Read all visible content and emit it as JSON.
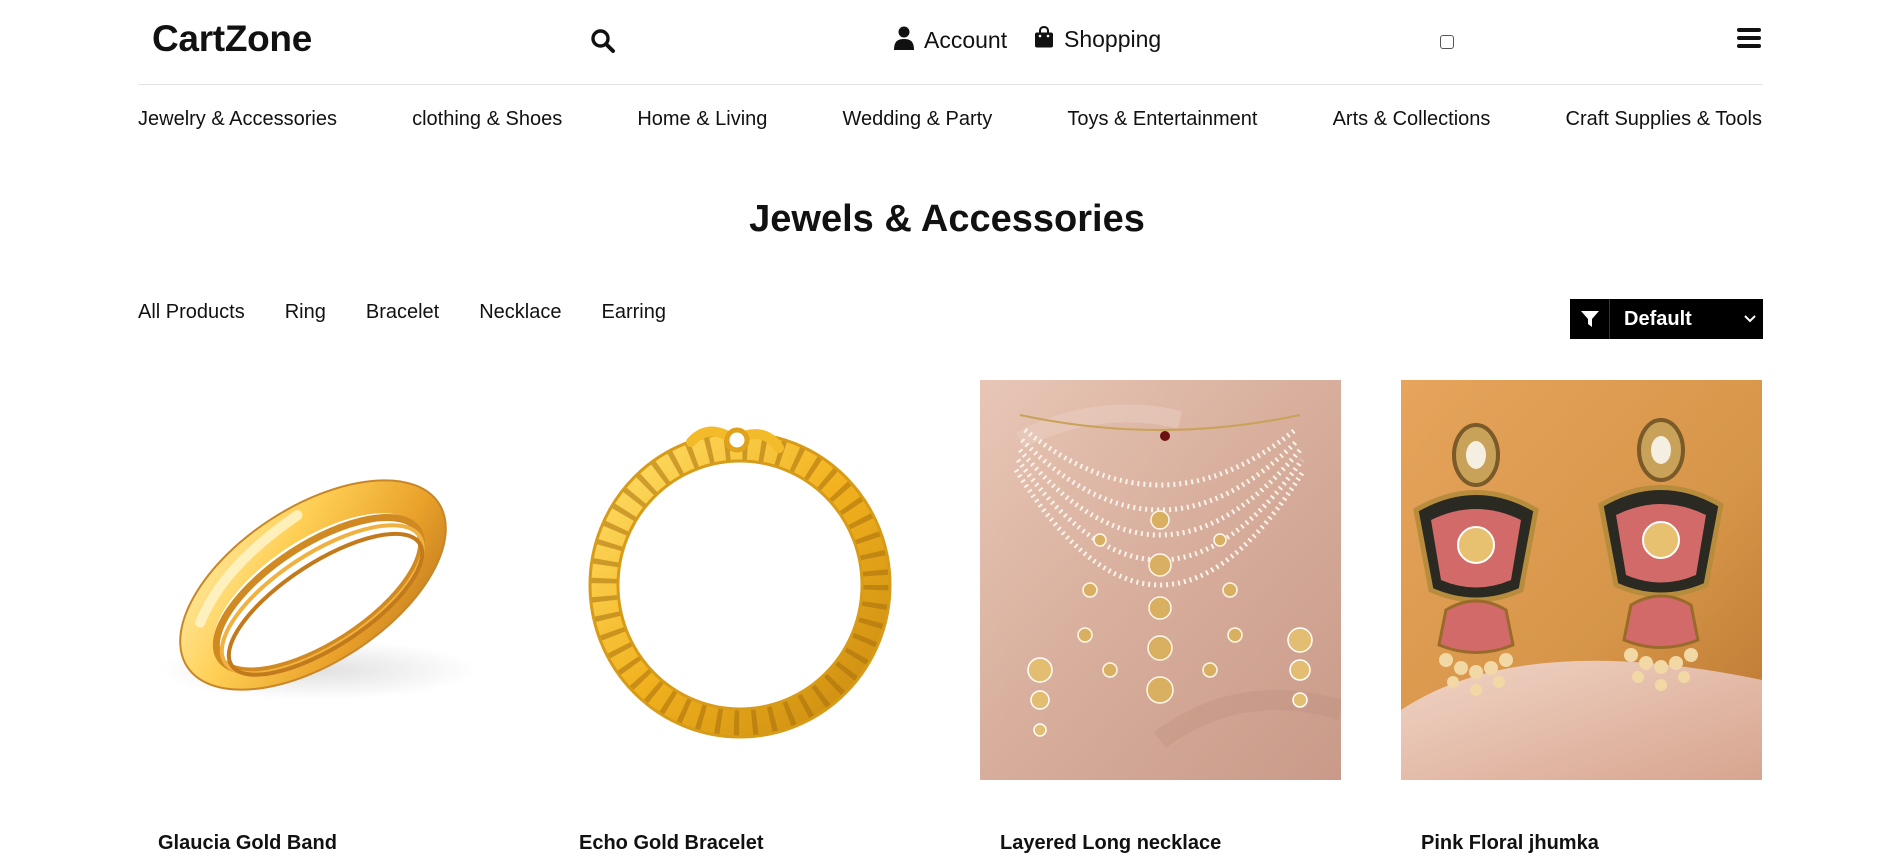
{
  "header": {
    "brand": "CartZone",
    "account_label": "Account",
    "shopping_label": "Shopping"
  },
  "category_nav": [
    {
      "label": "Jewelry & Accessories"
    },
    {
      "label": "clothing & Shoes"
    },
    {
      "label": "Home & Living"
    },
    {
      "label": "Wedding & Party"
    },
    {
      "label": "Toys & Entertainment"
    },
    {
      "label": "Arts & Collections"
    },
    {
      "label": "Craft Supplies & Tools"
    }
  ],
  "page_title": "Jewels & Accessories",
  "filter_tabs": [
    {
      "label": "All Products"
    },
    {
      "label": "Ring"
    },
    {
      "label": "Bracelet"
    },
    {
      "label": "Necklace"
    },
    {
      "label": "Earring"
    }
  ],
  "sort": {
    "selected": "Default"
  },
  "products": [
    {
      "name": "Glaucia Gold Band",
      "icon": "gold-ring-image"
    },
    {
      "name": "Echo Gold Bracelet",
      "icon": "gold-bracelet-image"
    },
    {
      "name": "Layered Long necklace",
      "icon": "layered-necklace-image"
    },
    {
      "name": "Pink Floral jhumka",
      "icon": "jhumka-earrings-image"
    }
  ],
  "colors": {
    "gold": "#e9a92c",
    "gold_light": "#ffd56a",
    "sort_bg": "#000000",
    "necklace_bg": "#dcb7a6",
    "jhumka_bg": "#d69548",
    "jhumka_pink": "#d36a6a"
  }
}
